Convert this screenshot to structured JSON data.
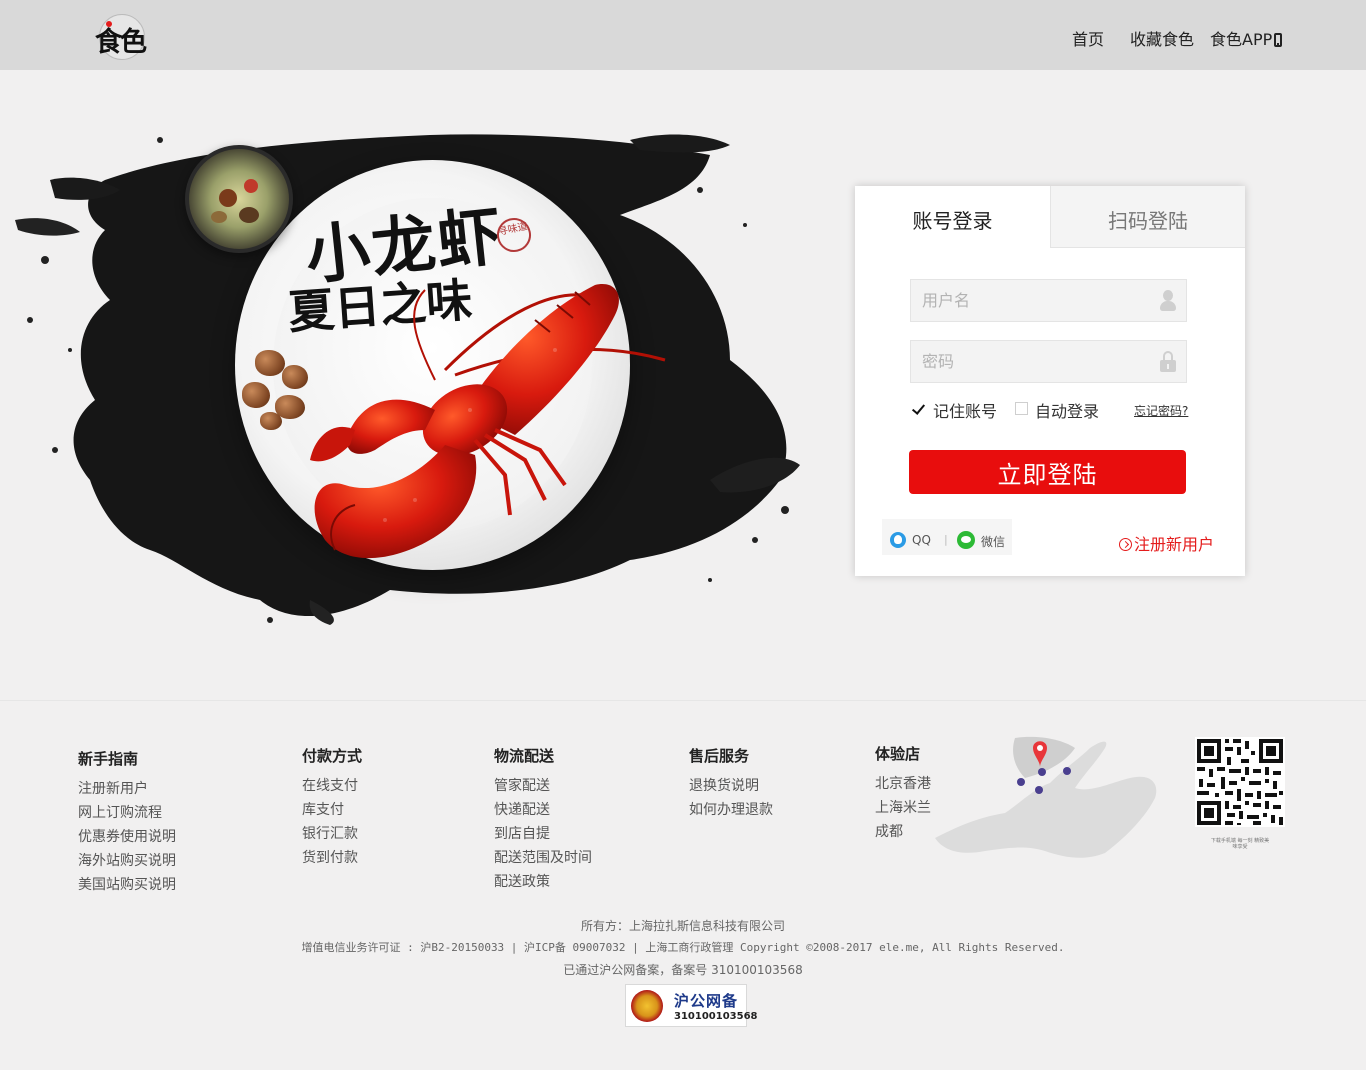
{
  "header": {
    "logo_text": "食色",
    "nav": [
      {
        "label": "首页"
      },
      {
        "label": "收藏食色"
      },
      {
        "label": "食色APP"
      }
    ]
  },
  "hero": {
    "title_line1": "小龙虾",
    "title_line2": "夏日之味",
    "seal_text": "寻味道"
  },
  "login": {
    "tab_account": "账号登录",
    "tab_qr": "扫码登陆",
    "username_placeholder": "用户名",
    "password_placeholder": "密码",
    "remember_label": "记住账号",
    "remember_checked": true,
    "auto_login_label": "自动登录",
    "auto_login_checked": false,
    "forgot_label": "忘记密码?",
    "submit_label": "立即登陆",
    "social_qq": "QQ",
    "social_separator": "|",
    "social_wechat": "微信",
    "register_label": "注册新用户"
  },
  "footer": {
    "columns": [
      {
        "title": "新手指南",
        "items": [
          "注册新用户",
          "网上订购流程",
          "优惠券使用说明",
          "海外站购买说明",
          "美国站购买说明"
        ]
      },
      {
        "title": "付款方式",
        "items": [
          "在线支付",
          "库支付",
          "银行汇款",
          "货到付款"
        ]
      },
      {
        "title": "物流配送",
        "items": [
          "管家配送",
          "快递配送",
          "到店自提",
          "配送范围及时间",
          "配送政策"
        ]
      },
      {
        "title": "售后服务",
        "items": [
          "退换货说明",
          "如何办理退款"
        ]
      },
      {
        "title": "体验店",
        "items": [
          "北京香港",
          "上海米兰",
          "成都"
        ]
      }
    ],
    "qr_caption": "下载手机端 每一刻 精致美味享受",
    "owner": "所有方：上海拉扎斯信息科技有限公司",
    "license": "增值电信业务许可证 : 沪B2-20150033 | 沪ICP备 09007032 | 上海工商行政管理 Copyright ©2008-2017 ele.me, All Rights Reserved.",
    "record": "已通过沪公网备案，备案号 310100103568",
    "badge_title": "沪公网备",
    "badge_number": "310100103568"
  },
  "colors": {
    "accent_red": "#e80d0d",
    "header_bg": "#d9d9d9",
    "page_bg": "#f1f0f0"
  }
}
